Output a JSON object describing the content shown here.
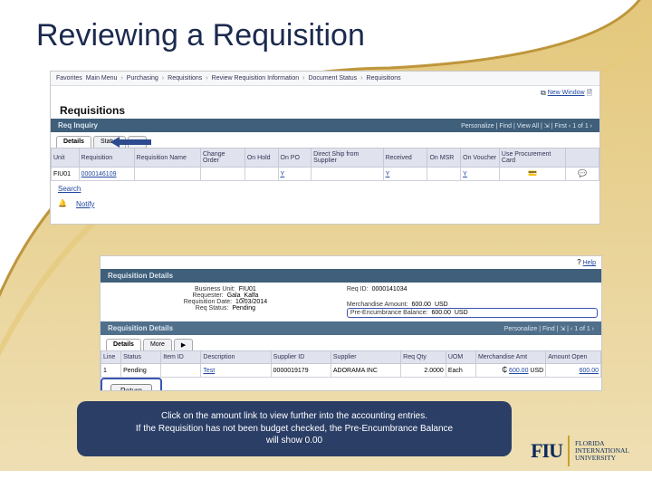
{
  "slide": {
    "title": "Reviewing a Requisition"
  },
  "shot1": {
    "crumbs": [
      "Favorites",
      "Main Menu",
      "Purchasing",
      "Requisitions",
      "Review Requisition Information",
      "Document Status",
      "Requisitions"
    ],
    "newwindow_label": "New Window",
    "page_title": "Requisitions",
    "section_title": "Req Inquiry",
    "grid_tools": "Personalize | Find | View All | ⇲ | First ‹ 1 of 1 ›",
    "tabs": [
      "Details",
      "Status"
    ],
    "icon_suffix": "▶",
    "cols": [
      "Unit",
      "Requisition",
      "Requisition Name",
      "Change Order",
      "On Hold",
      "On PO",
      "Direct Ship from Supplier",
      "Received",
      "On MSR",
      "On Voucher",
      "Use Procurement Card",
      ""
    ],
    "row": {
      "unit": "FIU01",
      "req": "0000146109",
      "name": "",
      "chg": "",
      "hold": "",
      "onpo": "Y",
      "direct": "",
      "recv": "Y",
      "onmsr": "",
      "onvch": "Y",
      "pcard": ""
    },
    "search_label": "Search",
    "notify_label": "Notify"
  },
  "shot2": {
    "help_label": "Help",
    "section_title": "Requisition Details",
    "left": {
      "bu_lbl": "Business Unit:",
      "bu": "FIU01",
      "rq_lbl": "Requester:",
      "rq": "Gala_Kalfa",
      "rd_lbl": "Requisition Date:",
      "rd": "10/03/2014",
      "rs_lbl": "Req Status:",
      "rs": "Pending"
    },
    "right": {
      "rid_lbl": "Req ID:",
      "rid": "0000141034",
      "m_lbl": "Merchandise Amount:",
      "m_val": "600.00",
      "m_cur": "USD",
      "pe_lbl": "Pre-Encumbrance Balance:",
      "pe_val": "600.00",
      "pe_cur": "USD"
    },
    "details_section_title": "Requisition Details",
    "grid_tabs": [
      "Details",
      "More"
    ],
    "grid_tools": "Personalize | Find | ⇲ | ‹ 1 of 1 ›",
    "cols": [
      "Line",
      "Status",
      "Item ID",
      "Description",
      "Supplier ID",
      "Supplier",
      "Req Qty",
      "UOM",
      "Merchandise Amt",
      "Amount Open"
    ],
    "row": {
      "line": "1",
      "status": "Pending",
      "item": "",
      "desc": "Test",
      "supid": "0000019179",
      "sup": "ADORAMA INC",
      "qty": "2.0000",
      "uom": "Each",
      "amt": "600.00",
      "amt_cur": "USD",
      "open": "600.00"
    },
    "return_label": "Return"
  },
  "callout": {
    "line1": "Click on the amount link to view further into the accounting entries.",
    "line2": "If the Requisition has not been budget checked, the Pre-Encumbrance Balance",
    "line3": "will show 0.00"
  },
  "logo": {
    "mark": "FIU",
    "line1": "FLORIDA",
    "line2": "INTERNATIONAL",
    "line3": "UNIVERSITY"
  }
}
